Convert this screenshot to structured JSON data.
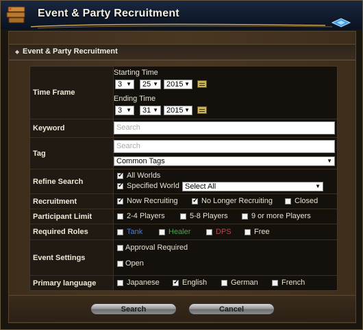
{
  "window": {
    "title": "Event & Party Recruitment"
  },
  "panel": {
    "header": "Event & Party Recruitment"
  },
  "time_frame": {
    "label": "Time Frame",
    "start_label": "Starting Time",
    "start": {
      "month": "3",
      "day": "25",
      "year": "2015"
    },
    "end_label": "Ending Time",
    "end": {
      "month": "3",
      "day": "31",
      "year": "2015"
    }
  },
  "keyword": {
    "label": "Keyword",
    "placeholder": "Search"
  },
  "tag": {
    "label": "Tag",
    "placeholder": "Search",
    "common_tags": "Common Tags"
  },
  "refine": {
    "label": "Refine Search",
    "all_worlds": "All Worlds",
    "all_worlds_checked": true,
    "specified_world": "Specified World",
    "specified_world_checked": true,
    "world_select": "Select All"
  },
  "recruitment": {
    "label": "Recruitment",
    "options": [
      {
        "text": "Now Recruiting",
        "checked": true
      },
      {
        "text": "No Longer Recruiting",
        "checked": true
      },
      {
        "text": "Closed",
        "checked": false
      }
    ]
  },
  "participant_limit": {
    "label": "Participant Limit",
    "options": [
      {
        "text": "2-4 Players",
        "checked": false
      },
      {
        "text": "5-8 Players",
        "checked": false
      },
      {
        "text": "9 or more Players",
        "checked": false
      }
    ]
  },
  "roles": {
    "label": "Required Roles",
    "options": [
      {
        "text": "Tank",
        "color": "#4a7fe0",
        "checked": false
      },
      {
        "text": "Healer",
        "color": "#49a84a",
        "checked": false
      },
      {
        "text": "DPS",
        "color": "#b84a4a",
        "checked": false
      },
      {
        "text": "Free",
        "color": "#e8e2d2",
        "checked": false
      }
    ]
  },
  "event_settings": {
    "label": "Event Settings",
    "approval": "Approval Required",
    "approval_checked": false,
    "open": "Open",
    "open_checked": false
  },
  "language": {
    "label": "Primary language",
    "options": [
      {
        "text": "Japanese",
        "checked": false
      },
      {
        "text": "English",
        "checked": true
      },
      {
        "text": "German",
        "checked": false
      },
      {
        "text": "French",
        "checked": false
      }
    ]
  },
  "buttons": {
    "search": "Search",
    "cancel": "Cancel"
  }
}
